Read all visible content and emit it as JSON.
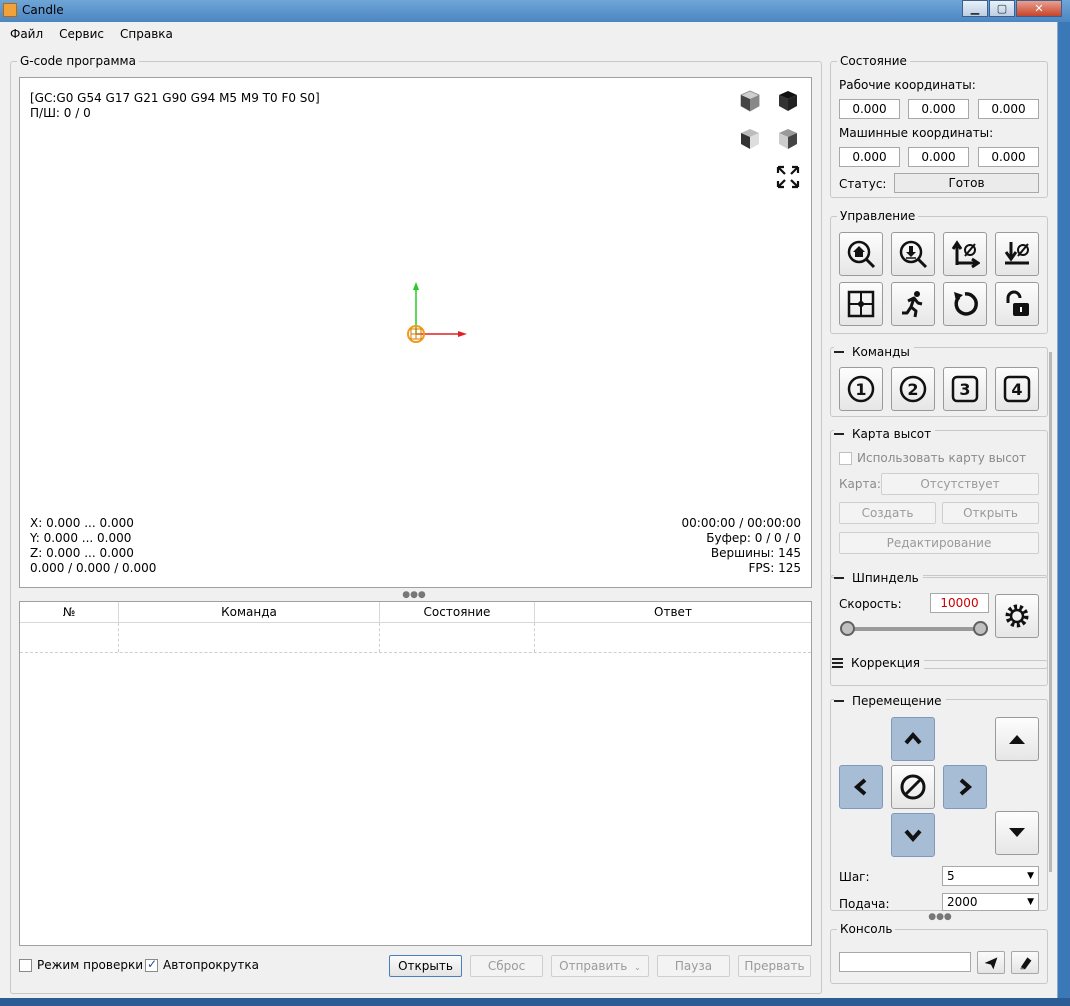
{
  "window": {
    "title": "Candle"
  },
  "menu": [
    "Файл",
    "Сервис",
    "Справка"
  ],
  "gcode": {
    "group_title": "G-code программа",
    "state_line": "[GC:G0 G54 G17 G21 G90 G94 M5 M9 T0 F0 S0]",
    "ps_line": "П/Ш: 0 / 0",
    "x_range": "X: 0.000 ... 0.000",
    "y_range": "Y: 0.000 ... 0.000",
    "z_range": "Z: 0.000 ... 0.000",
    "xyz_total": "0.000 / 0.000 / 0.000",
    "time": "00:00:00 / 00:00:00",
    "buffer": "Буфер: 0 / 0 / 0",
    "vertices": "Вершины: 145",
    "fps": "FPS: 125"
  },
  "table": {
    "columns": [
      "№",
      "Команда",
      "Состояние",
      "Ответ"
    ]
  },
  "bottom": {
    "check_mode_label": "Режим проверки",
    "check_mode_checked": false,
    "autoscroll_label": "Автопрокрутка",
    "autoscroll_checked": true,
    "open_label": "Открыть",
    "reset_label": "Сброс",
    "send_label": "Отправить",
    "pause_label": "Пауза",
    "abort_label": "Прервать"
  },
  "state": {
    "title": "Состояние",
    "work_label": "Рабочие координаты:",
    "work": [
      "0.000",
      "0.000",
      "0.000"
    ],
    "machine_label": "Машинные координаты:",
    "machine": [
      "0.000",
      "0.000",
      "0.000"
    ],
    "status_label": "Статус:",
    "status_value": "Готов"
  },
  "control": {
    "title": "Управление",
    "icons": [
      "home-icon",
      "probe-z-icon",
      "zero-xy-icon",
      "zero-z-icon",
      "origin-target-icon",
      "run-icon",
      "reset-icon",
      "unlock-icon"
    ]
  },
  "commands": {
    "title": "Команды",
    "buttons": [
      "1",
      "2",
      "3",
      "4"
    ]
  },
  "heightmap": {
    "title": "Карта высот",
    "use_label": "Использовать карту высот",
    "map_label": "Карта:",
    "map_value": "Отсутствует",
    "create_label": "Создать",
    "open_label": "Открыть",
    "edit_label": "Редактирование"
  },
  "spindle": {
    "title": "Шпиндель",
    "speed_label": "Скорость:",
    "speed_value": "10000",
    "slider_fraction": 1.0,
    "speed_color": "#cc0000"
  },
  "correction": {
    "title": "Коррекция"
  },
  "jog": {
    "title": "Перемещение",
    "step_label": "Шаг:",
    "step_value": "5",
    "feed_label": "Подача:",
    "feed_value": "2000"
  },
  "console": {
    "title": "Консоль",
    "input_value": ""
  }
}
